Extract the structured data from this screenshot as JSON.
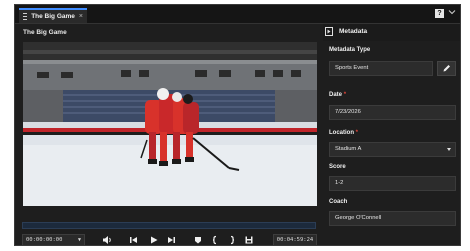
{
  "tab": {
    "title": "The Big Game",
    "close": "×",
    "help": "?"
  },
  "video": {
    "title": "The Big Game",
    "timecode_start": "00:00:00:00",
    "timecode_end": "00:04:59:24"
  },
  "metadata": {
    "title": "Metadata",
    "fields": {
      "metadata_type": {
        "label": "Metadata Type",
        "value": "Sports Event"
      },
      "date": {
        "label": "Date",
        "required": "*",
        "value": "7/23/2026"
      },
      "location": {
        "label": "Location",
        "required": "*",
        "value": "Stadium A"
      },
      "score": {
        "label": "Score",
        "value": "1-2"
      },
      "coach": {
        "label": "Coach",
        "value": "George O'Connell"
      }
    }
  },
  "colors": {
    "accent": "#3f8cff",
    "required": "#e0453a",
    "jersey": "#d8322b"
  }
}
